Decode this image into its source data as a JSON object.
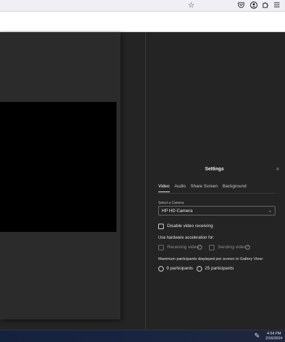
{
  "browser": {
    "icons": [
      "star-icon",
      "pocket-icon",
      "account-icon",
      "extensions-icon",
      "menu-icon"
    ]
  },
  "settings": {
    "title": "Settings",
    "close_glyph": "×",
    "tabs": [
      "Video",
      "Audio",
      "Share Screen",
      "Background"
    ],
    "active_tab": "Video",
    "camera": {
      "label": "Select a Camera",
      "value": "HP HD Camera"
    },
    "disable_video_receiving": {
      "label": "Disable video receiving",
      "checked": false
    },
    "hardware_acceleration": {
      "label": "Use hardware acceleration for:",
      "receiving_label": "Receiving video",
      "sending_label": "Sending video",
      "help_glyph": "?"
    },
    "gallery": {
      "label": "Maximum participants displayed per screen in Gallery View:",
      "options": [
        "9 participants",
        "25 participants"
      ]
    }
  },
  "taskbar": {
    "time": "4:54 PM",
    "date": "2/16/2024"
  }
}
